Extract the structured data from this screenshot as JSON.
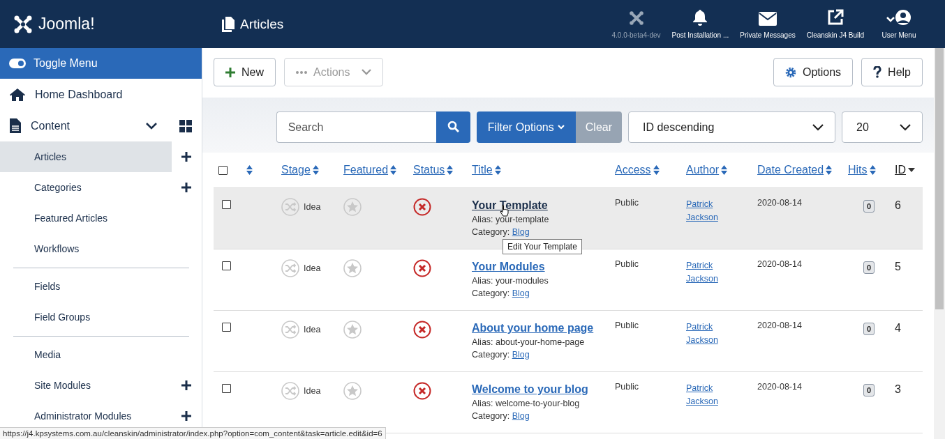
{
  "header": {
    "logo": "Joomla!",
    "page_title": "Articles",
    "items": [
      {
        "kind": "version",
        "label": "4.0.0-beta4-dev"
      },
      {
        "kind": "bell",
        "label": "Post Installation ..."
      },
      {
        "kind": "mail",
        "label": "Private Messages"
      },
      {
        "kind": "external",
        "label": "Cleanskin J4 Build"
      },
      {
        "kind": "user",
        "label": "User Menu"
      }
    ]
  },
  "sidebar": {
    "toggle": {
      "label": "Toggle Menu",
      "on": true
    },
    "home": {
      "label": "Home Dashboard"
    },
    "content": {
      "label": "Content",
      "expanded": true,
      "groups": [
        [
          {
            "label": "Articles",
            "selected": true,
            "add": true
          },
          {
            "label": "Categories",
            "selected": false,
            "add": true
          },
          {
            "label": "Featured Articles",
            "selected": false,
            "add": false
          },
          {
            "label": "Workflows",
            "selected": false,
            "add": false
          }
        ],
        [
          {
            "label": "Fields",
            "selected": false,
            "add": false
          },
          {
            "label": "Field Groups",
            "selected": false,
            "add": false
          }
        ],
        [
          {
            "label": "Media",
            "selected": false,
            "add": false
          },
          {
            "label": "Site Modules",
            "selected": false,
            "add": true
          },
          {
            "label": "Administrator Modules",
            "selected": false,
            "add": true
          }
        ]
      ]
    }
  },
  "toolbar": {
    "left": [
      {
        "kind": "new",
        "label": "New",
        "disabled": false
      },
      {
        "kind": "actions",
        "label": "Actions",
        "disabled": true
      }
    ],
    "right": [
      {
        "kind": "options",
        "label": "Options",
        "disabled": false
      },
      {
        "kind": "help",
        "label": "Help",
        "disabled": false
      }
    ]
  },
  "filters": {
    "search": {
      "placeholder": "Search"
    },
    "filter_button": "Filter Options",
    "clear_button": {
      "label": "Clear",
      "disabled": true
    },
    "ordering": "ID descending",
    "limit": "20"
  },
  "table": {
    "select_all_checked": false,
    "columns": [
      {
        "label": "Stage",
        "active": false
      },
      {
        "label": "Featured",
        "active": false
      },
      {
        "label": "Status",
        "active": false
      },
      {
        "label": "Title",
        "active": false
      },
      {
        "label": "Access",
        "active": false
      },
      {
        "label": "Author",
        "active": false
      },
      {
        "label": "Date Created",
        "active": false
      },
      {
        "label": "Hits",
        "active": false
      },
      {
        "label": "ID",
        "active": true
      }
    ],
    "rows": [
      {
        "stage": "Idea",
        "title": "Your Template",
        "alias": "Alias: your-template",
        "category_label": "Category:",
        "category": "Blog",
        "access": "Public",
        "author": "Patrick Jackson",
        "date": "2020-08-14",
        "hits": "0",
        "id": "6",
        "hovered": true,
        "checked": false
      },
      {
        "stage": "Idea",
        "title": "Your Modules",
        "alias": "Alias: your-modules",
        "category_label": "Category:",
        "category": "Blog",
        "access": "Public",
        "author": "Patrick Jackson",
        "date": "2020-08-14",
        "hits": "0",
        "id": "5",
        "hovered": false,
        "checked": false
      },
      {
        "stage": "Idea",
        "title": "About your home page",
        "alias": "Alias: about-your-home-page",
        "category_label": "Category:",
        "category": "Blog",
        "access": "Public",
        "author": "Patrick Jackson",
        "date": "2020-08-14",
        "hits": "0",
        "id": "4",
        "hovered": false,
        "checked": false
      },
      {
        "stage": "Idea",
        "title": "Welcome to your blog",
        "alias": "Alias: welcome-to-your-blog",
        "category_label": "Category:",
        "category": "Blog",
        "access": "Public",
        "author": "Patrick Jackson",
        "date": "2020-08-14",
        "hits": "0",
        "id": "3",
        "hovered": false,
        "checked": false
      }
    ]
  },
  "tooltip": "Edit Your Template",
  "status_url": "https://j4.kpsystems.com.au/cleanskin/administrator/index.php?option=com_content&task=article.edit&id=6"
}
